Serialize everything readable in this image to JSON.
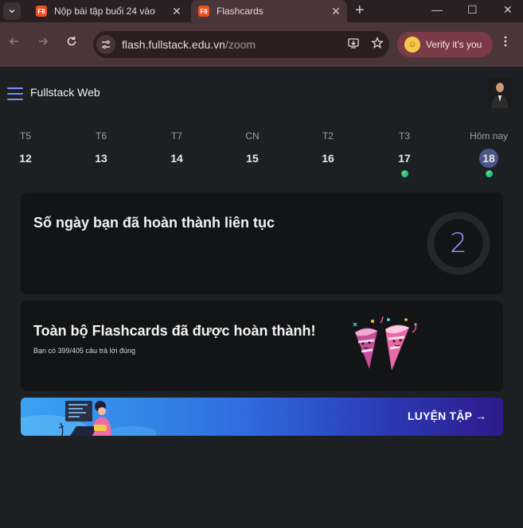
{
  "browser": {
    "tabs": [
      {
        "favicon": "F8",
        "title": "Nộp bài tập buổi 24 vào",
        "close": "✕"
      },
      {
        "favicon": "F8",
        "title": "Flashcards",
        "close": "✕"
      }
    ],
    "new_tab": "+",
    "window_controls": {
      "minimize": "—",
      "maximize": "☐",
      "close": "✕"
    },
    "url_host": "flash.fullstack.edu.vn",
    "url_path": "/zoom",
    "verify_label": "Verify it's you"
  },
  "header": {
    "brand": "Fullstack Web"
  },
  "week": [
    {
      "name": "T5",
      "date": "12",
      "done": false
    },
    {
      "name": "T6",
      "date": "13",
      "done": false
    },
    {
      "name": "T7",
      "date": "14",
      "done": false
    },
    {
      "name": "CN",
      "date": "15",
      "done": false
    },
    {
      "name": "T2",
      "date": "16",
      "done": false
    },
    {
      "name": "T3",
      "date": "17",
      "done": true
    },
    {
      "name": "Hôm nay",
      "date": "18",
      "done": true,
      "today": true
    }
  ],
  "streak": {
    "title": "Số ngày bạn đã hoàn thành liên tục",
    "count": "2"
  },
  "completion": {
    "title": "Toàn bộ Flashcards đã được hoàn thành!",
    "subtitle": "Bạn có 399/405 câu trả lời đúng"
  },
  "practice": {
    "cta": "LUYỆN TẬP →"
  },
  "colors": {
    "accent": "#7d8ff5",
    "done_dot": "#2ec77a",
    "today_bg": "#4a5687",
    "favicon": "#f05123"
  }
}
